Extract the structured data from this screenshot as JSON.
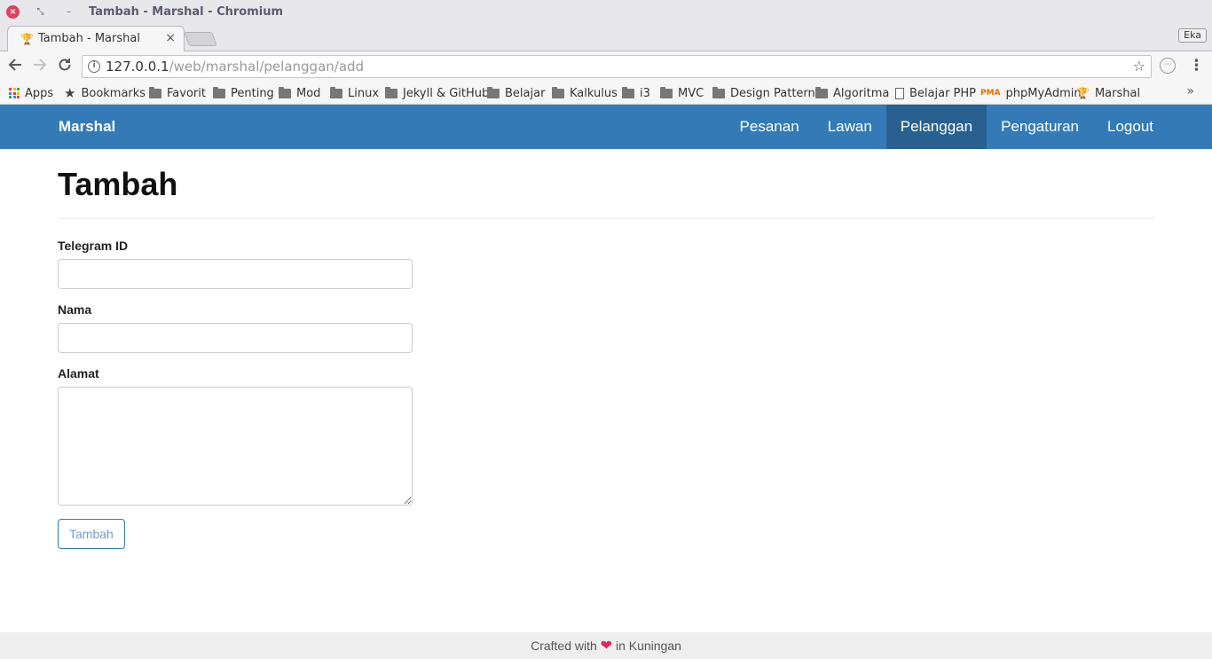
{
  "window": {
    "title": "Tambah - Marshal - Chromium",
    "close_glyph": "×",
    "restore_glyph": "⤡",
    "minimize_glyph": "–"
  },
  "tab": {
    "title": "Tambah - Marshal",
    "close_glyph": "×",
    "favicon": "trophy-icon"
  },
  "profile": {
    "name": "Eka"
  },
  "address_bar": {
    "host": "127.0.0.1",
    "path": "/web/marshal/pelanggan/add"
  },
  "bookmarks": {
    "items": [
      {
        "label": "Apps",
        "icon": "apps-grid-icon"
      },
      {
        "label": "Bookmarks",
        "icon": "star-icon"
      },
      {
        "label": "Favorit",
        "icon": "folder-icon"
      },
      {
        "label": "Penting",
        "icon": "folder-icon"
      },
      {
        "label": "Mod",
        "icon": "folder-icon"
      },
      {
        "label": "Linux",
        "icon": "folder-icon"
      },
      {
        "label": "Jekyll & GitHub",
        "icon": "folder-icon"
      },
      {
        "label": "Belajar",
        "icon": "folder-icon"
      },
      {
        "label": "Kalkulus",
        "icon": "folder-icon"
      },
      {
        "label": "i3",
        "icon": "folder-icon"
      },
      {
        "label": "MVC",
        "icon": "folder-icon"
      },
      {
        "label": "Design Pattern",
        "icon": "folder-icon"
      },
      {
        "label": "Algoritma",
        "icon": "folder-icon"
      },
      {
        "label": "Belajar PHP",
        "icon": "page-icon"
      },
      {
        "label": "phpMyAdmin",
        "icon": "phpmyadmin-icon"
      },
      {
        "label": "Marshal",
        "icon": "trophy-icon"
      }
    ],
    "more": "»"
  },
  "navbar": {
    "brand": "Marshal",
    "items": [
      {
        "label": "Pesanan"
      },
      {
        "label": "Lawan"
      },
      {
        "label": "Pelanggan"
      },
      {
        "label": "Pengaturan"
      },
      {
        "label": "Logout"
      }
    ],
    "active": "Pelanggan",
    "color": "#337ab7",
    "active_color": "#286090"
  },
  "page": {
    "title": "Tambah"
  },
  "form": {
    "telegram_label": "Telegram ID",
    "telegram_value": "",
    "nama_label": "Nama",
    "nama_value": "",
    "alamat_label": "Alamat",
    "alamat_value": "",
    "submit_label": "Tambah"
  },
  "footer": {
    "before": "Crafted with",
    "heart": "❤",
    "after": "in Kuningan"
  }
}
